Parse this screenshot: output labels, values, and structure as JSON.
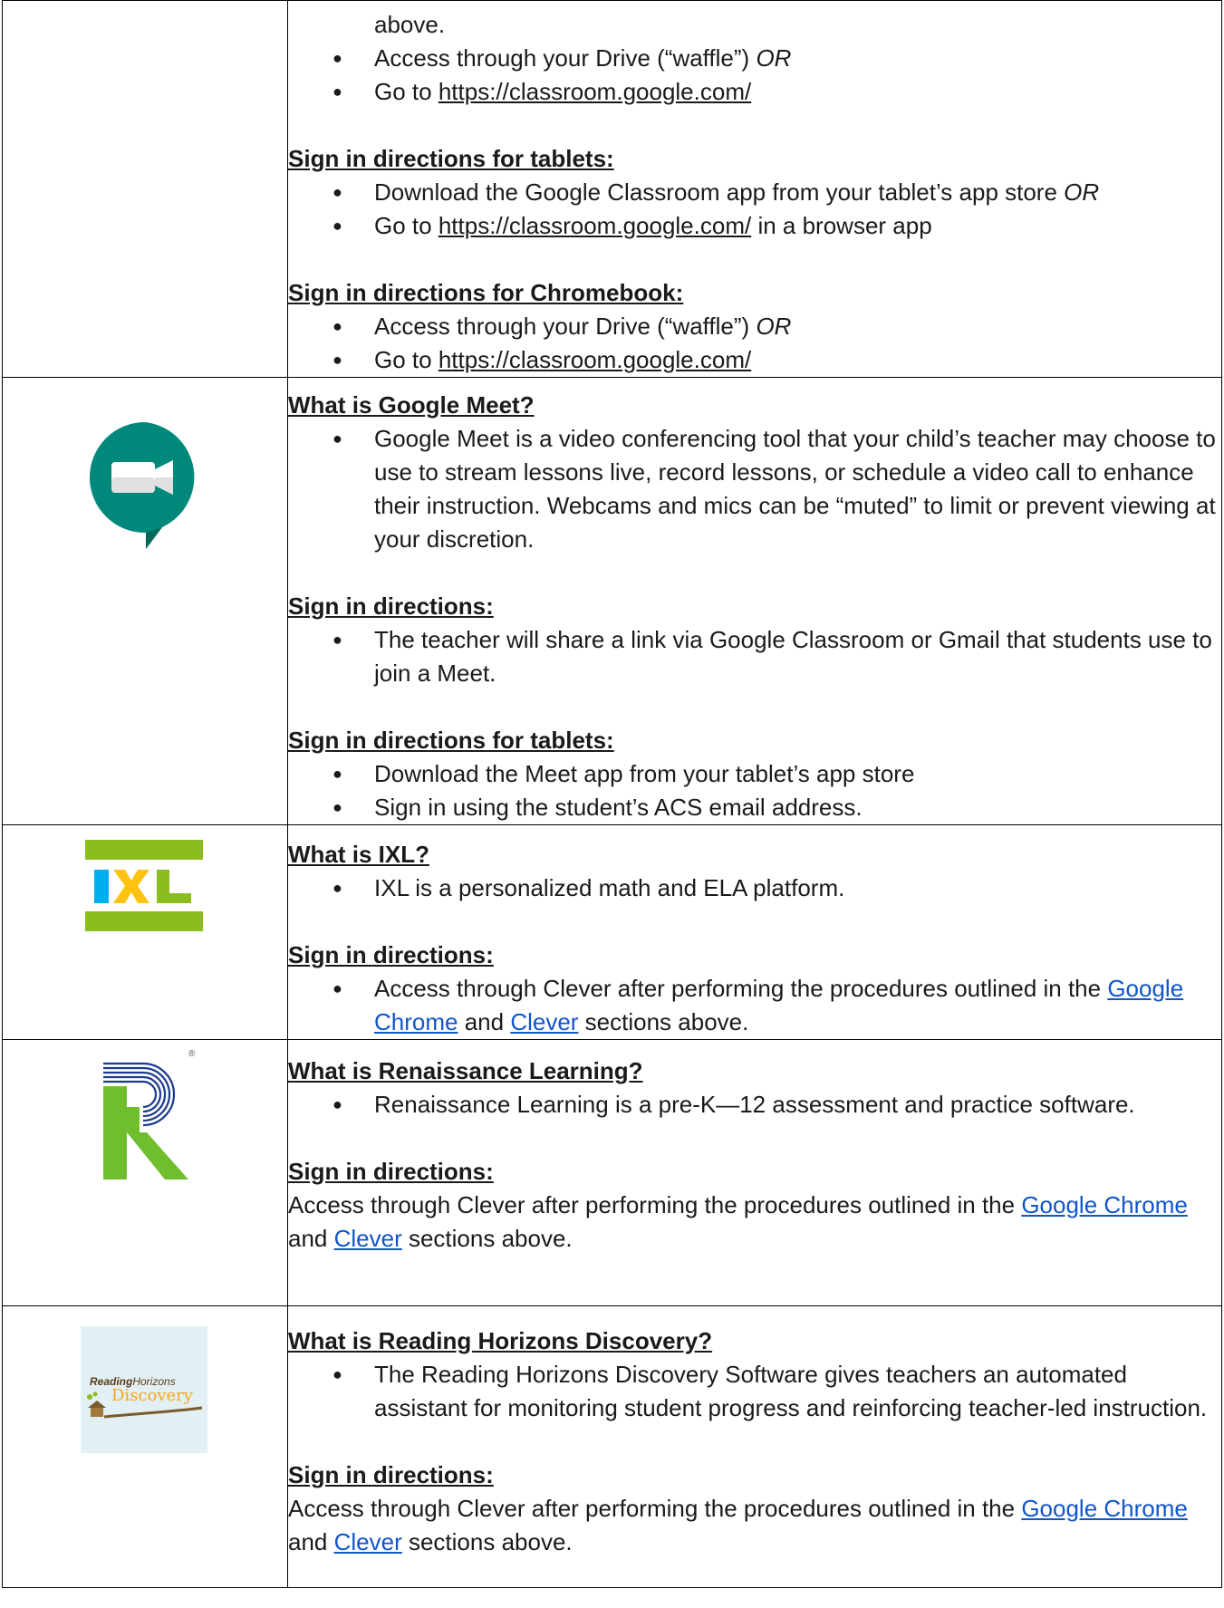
{
  "row_classroom": {
    "continuation": "above.",
    "bullets_top": [
      {
        "text": "Access through your Drive  (“waffle”) ",
        "suffix": "OR"
      },
      {
        "prefix": "Go to ",
        "link": "https://classroom.google.com/"
      }
    ],
    "tablets_heading": "Sign in directions for tablets:",
    "tablets_bullets": [
      {
        "text": "Download the Google Classroom app from your tablet’s app store ",
        "suffix": "OR"
      },
      {
        "prefix": "Go to ",
        "link": "https://classroom.google.com/",
        "after": " in a browser app"
      }
    ],
    "chromebook_heading": "Sign in directions for Chromebook:",
    "chromebook_bullets": [
      {
        "text": "Access through your Drive (“waffle”) ",
        "suffix": "OR"
      },
      {
        "prefix": "Go to ",
        "link": "https://classroom.google.com/"
      }
    ]
  },
  "row_meet": {
    "icon": "google-meet-icon",
    "heading": "What is Google Meet?",
    "bullet": "Google Meet is a video conferencing tool that your child’s teacher may choose to use to stream lessons live, record lessons, or schedule a video call to enhance their instruction.  Webcams and mics can be “muted” to limit or prevent viewing at your discretion.",
    "signin_heading": "Sign in directions:",
    "signin_bullet": "The teacher will share a link via Google Classroom or Gmail that students use to join a Meet.",
    "tablets_heading": "Sign in directions for tablets:",
    "tablets_bullets": [
      "Download the Meet app from your tablet’s app store",
      "Sign in using the student’s ACS email address."
    ]
  },
  "row_ixl": {
    "icon": "ixl-logo",
    "logo_text": "IXL",
    "heading": "What is IXL?",
    "bullet": "IXL is a personalized math and ELA platform.",
    "signin_heading": "Sign in directions:",
    "signin_prefix": "Access through Clever after performing the procedures outlined in the ",
    "link1": "Google Chrome",
    "mid": " and ",
    "link2": "Clever",
    "suffix": " sections above."
  },
  "row_renaissance": {
    "icon": "renaissance-logo",
    "registered": "®",
    "heading": "What is Renaissance Learning?",
    "bullet": "Renaissance Learning is a pre-K—12 assessment and practice software.",
    "signin_heading": "Sign in directions:",
    "signin_prefix": "Access through Clever after performing the procedures outlined in the ",
    "link1": "Google Chrome",
    "mid": " and ",
    "link2": "Clever",
    "suffix": " sections above."
  },
  "row_reading": {
    "icon": "reading-horizons-logo",
    "logo_word1": "Reading",
    "logo_word2": "Horizons",
    "logo_word3": "Discovery",
    "heading": "What is Reading Horizons Discovery?",
    "bullet": "The Reading Horizons Discovery Software gives teachers an automated assistant for monitoring student progress and reinforcing teacher-led instruction.",
    "signin_heading": "Sign in directions:",
    "signin_prefix": "Access through Clever after performing the procedures outlined in the ",
    "link1": "Google Chrome",
    "mid": " and ",
    "link2": "Clever",
    "suffix": " sections above."
  },
  "colors": {
    "link_blue": "#1155cc",
    "meet_green": "#00897b",
    "ixl_green": "#8cbd1f",
    "ixl_blue": "#00aeef",
    "ixl_yellow": "#ffc20e",
    "renaissance_green": "#6fbe2e",
    "renaissance_blue": "#1b3a8c"
  }
}
